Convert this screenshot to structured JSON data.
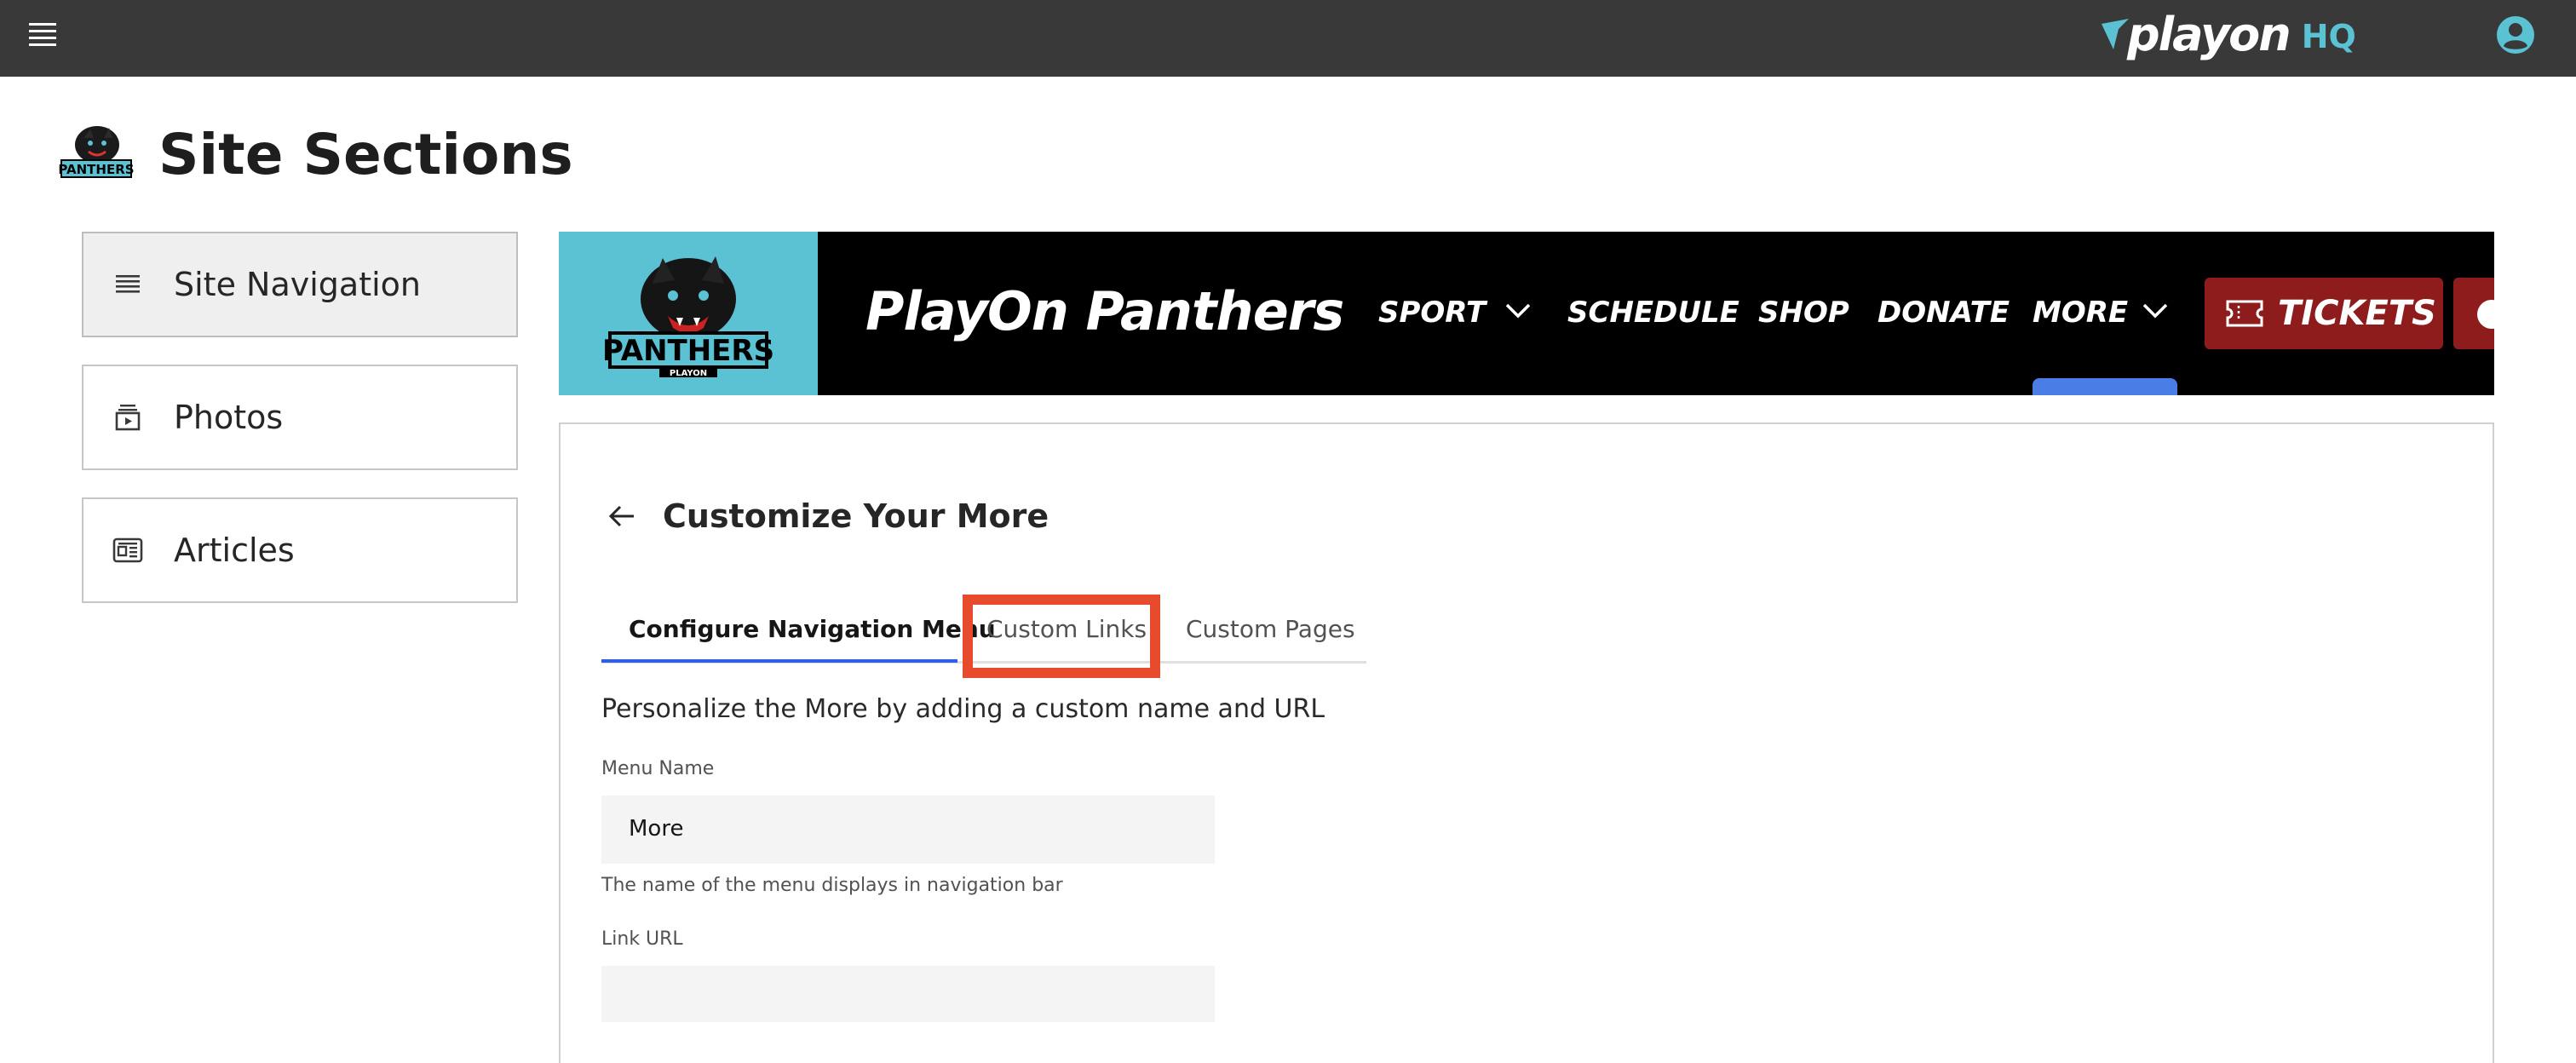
{
  "topbar": {
    "brand_word": "playon",
    "brand_suffix": "HQ"
  },
  "page": {
    "title": "Site Sections",
    "logo_text": "PANTHERS"
  },
  "sidebar": {
    "items": [
      {
        "label": "Site Navigation",
        "icon": "list-icon",
        "active": true
      },
      {
        "label": "Photos",
        "icon": "photo-gallery-icon",
        "active": false
      },
      {
        "label": "Articles",
        "icon": "newspaper-icon",
        "active": false
      }
    ]
  },
  "preview": {
    "logo_text": "PANTHERS",
    "logo_subtext": "PLAYON",
    "team_name": "PlayOn Panthers",
    "nav": [
      "SPORT",
      "SCHEDULE",
      "SHOP",
      "DONATE",
      "MORE"
    ],
    "tickets_label": "TICKETS",
    "colors": {
      "logo_bg": "#5bc2d4",
      "bar_bg": "#000000",
      "button": "#8f1c1c",
      "indicator": "#4a7de6"
    }
  },
  "customize": {
    "title": "Customize Your More",
    "tabs": [
      {
        "label": "Configure Navigation Menu",
        "active": true
      },
      {
        "label": "Custom Links",
        "active": false,
        "highlighted": true
      },
      {
        "label": "Custom Pages",
        "active": false
      }
    ],
    "description": "Personalize the More by adding a custom name and URL",
    "menu_name_label": "Menu Name",
    "menu_name_value": "More",
    "menu_name_helper": "The name of the menu displays in navigation bar",
    "link_url_label": "Link URL",
    "link_url_value": ""
  },
  "colors": {
    "topbar": "#393939",
    "accent": "#2f5fe6",
    "highlight": "#e84a2e"
  }
}
